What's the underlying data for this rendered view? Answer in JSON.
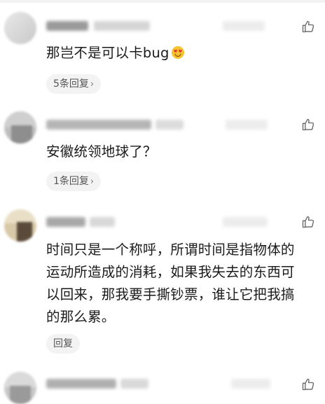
{
  "comments": [
    {
      "text": "那岂不是可以卡bug",
      "emoji": "heart-eyes-emoji",
      "reply_label": "5条回复",
      "reply_chevron": "›"
    },
    {
      "text": "安徽统领地球了？",
      "reply_label": "1条回复",
      "reply_chevron": "›"
    },
    {
      "text_lines": [
        "时间只是一个称呼，所谓时间是指物体的",
        "运动所造成的消耗，如果我失去的东西可",
        "以回来，那我要手撕钞票，谁让它把我搞",
        "的那么累。"
      ],
      "reply_label": "回复"
    },
    {
      "text": ""
    }
  ],
  "icons": {
    "like": "thumbs-up-outline-icon"
  },
  "colors": {
    "reply_pill_bg": "#f3f3f3",
    "text": "#1a1a1a",
    "icon": "#666666"
  }
}
